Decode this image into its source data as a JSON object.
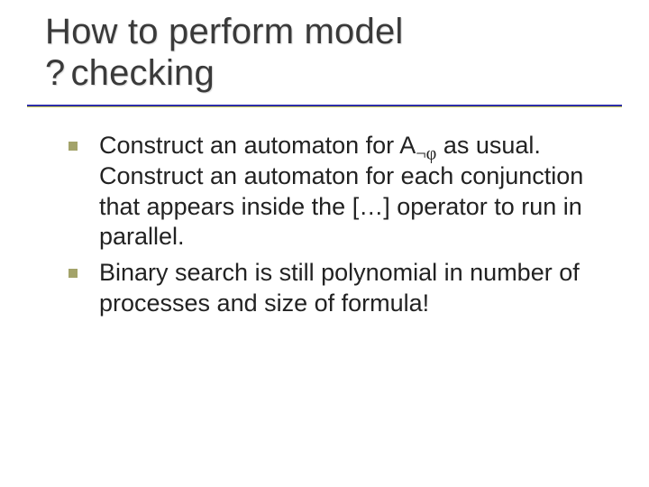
{
  "title": {
    "line1": "How to perform model",
    "line2_prefix": "?",
    "line2_rest": "checking"
  },
  "bullets": [
    {
      "pre": "Construct an automaton for A",
      "sub": "¬φ",
      "post": " as usual. Construct an automaton for each conjunction that appears inside the […] operator to run in parallel."
    },
    {
      "pre": "Binary search is still polynomial in number of processes and size of formula!",
      "sub": "",
      "post": ""
    }
  ],
  "icons": {
    "bullet": "square-bullet-icon"
  }
}
